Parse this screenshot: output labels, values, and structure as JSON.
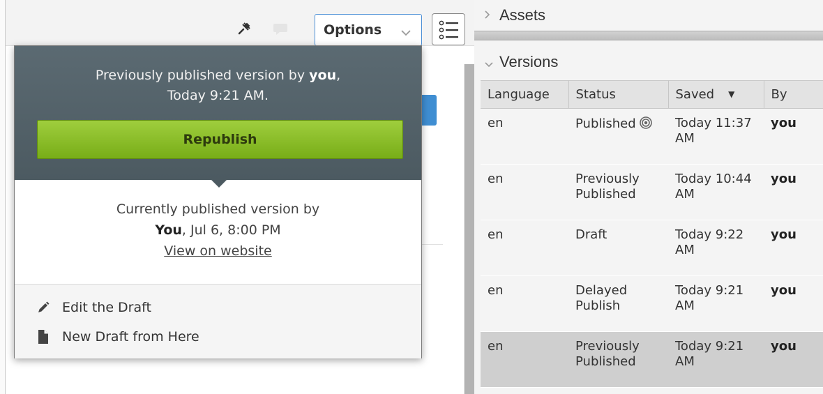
{
  "toolbar": {
    "options_label": "Options",
    "icons": [
      "pin-icon",
      "comment-icon",
      "chevron-down-icon",
      "list-icon"
    ]
  },
  "popover": {
    "previous_prefix": "Previously published version by",
    "previous_user": "you",
    "previous_time": "Today 9:21 AM.",
    "republish_label": "Republish",
    "current_prefix": "Currently published version by",
    "current_user": "You",
    "current_time": ", Jul 6, 8:00 PM",
    "view_link": "View on website",
    "menu": [
      {
        "label": "Edit the Draft",
        "icon": "pencil-icon"
      },
      {
        "label": "New Draft from Here",
        "icon": "document-icon"
      }
    ]
  },
  "panel": {
    "assets_title": "Assets",
    "versions_title": "Versions",
    "columns": [
      "Language",
      "Status",
      "Saved",
      "By"
    ],
    "sort_indicator": "▼",
    "rows": [
      {
        "language": "en",
        "status": "Published",
        "saved": "Today 11:37 AM",
        "by": "you",
        "published_icon": true
      },
      {
        "language": "en",
        "status": "Previously Published",
        "saved": "Today 10:44 AM",
        "by": "you"
      },
      {
        "language": "en",
        "status": "Draft",
        "saved": "Today 9:22 AM",
        "by": "you"
      },
      {
        "language": "en",
        "status": "Delayed Publish",
        "saved": "Today 9:21 AM",
        "by": "you"
      },
      {
        "language": "en",
        "status": "Previously Published",
        "saved": "Today 9:21 AM",
        "by": "you",
        "selected": true
      }
    ]
  },
  "colors": {
    "accent_blue": "#3f8ed2",
    "republish_green": "#8dc02b",
    "popover_header": "#55636a",
    "selected_row": "#cfcfcf"
  }
}
